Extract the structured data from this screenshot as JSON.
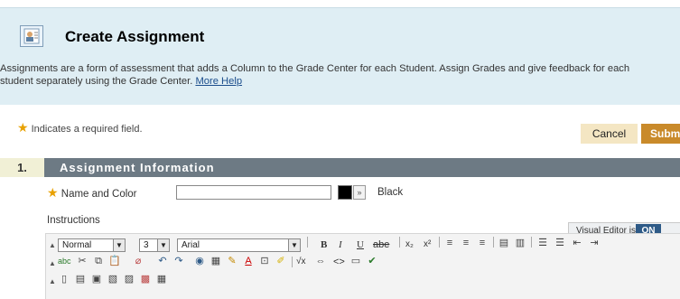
{
  "page": {
    "title": "Create Assignment",
    "description_line1": "Assignments are a form of assessment that adds a Column to the Grade Center for each Student. Assign Grades and give feedback for each",
    "description_line2": "student separately using the Grade Center.",
    "more_help_link": "More Help"
  },
  "required_note": "Indicates a required field.",
  "buttons": {
    "cancel": "Cancel",
    "submit": "Submit"
  },
  "section": {
    "number": "1.",
    "title": "Assignment Information"
  },
  "name_field": {
    "label": "Name and Color",
    "value": "",
    "color_name": "Black",
    "color_hex": "#000000"
  },
  "instructions": {
    "label": "Instructions"
  },
  "visual_editor": {
    "label": "Visual Editor is:",
    "state": "ON"
  },
  "toolbar": {
    "format_select": "Normal",
    "size_select": "3",
    "font_select": "Arial",
    "bold": "B",
    "italic": "I",
    "underline": "U",
    "strikethrough": "abe",
    "subscript": "x₂",
    "superscript": "x²",
    "math": "√x",
    "html_code": "<>"
  }
}
